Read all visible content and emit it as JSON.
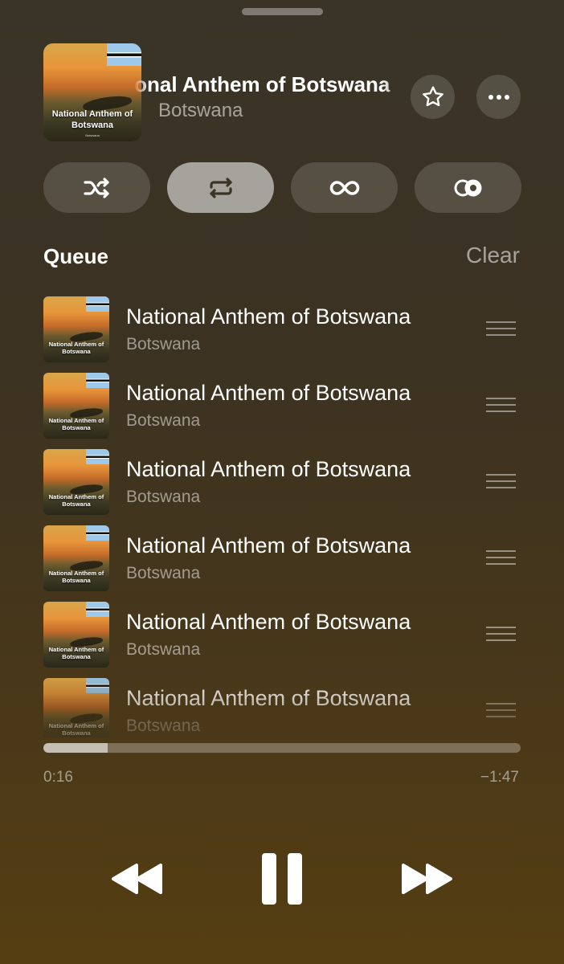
{
  "now_playing": {
    "title": "National Anthem of Botswana",
    "artist": "Botswana",
    "artwork_caption": "National Anthem of Botswana",
    "artwork_mini": "Botswana"
  },
  "modes": {
    "shuffle": "shuffle-icon",
    "repeat": "repeat-icon",
    "autoplay": "infinity-icon",
    "crossfade": "crossfade-icon",
    "active": "repeat"
  },
  "queue": {
    "label": "Queue",
    "clear_label": "Clear",
    "items": [
      {
        "title": "National Anthem of Botswana",
        "artist": "Botswana",
        "art_caption": "National Anthem of Botswana"
      },
      {
        "title": "National Anthem of Botswana",
        "artist": "Botswana",
        "art_caption": "National Anthem of Botswana"
      },
      {
        "title": "National Anthem of Botswana",
        "artist": "Botswana",
        "art_caption": "National Anthem of Botswana"
      },
      {
        "title": "National Anthem of Botswana",
        "artist": "Botswana",
        "art_caption": "National Anthem of Botswana"
      },
      {
        "title": "National Anthem of Botswana",
        "artist": "Botswana",
        "art_caption": "National Anthem of Botswana"
      },
      {
        "title": "National Anthem of Botswana",
        "artist": "Botswana",
        "art_caption": "National Anthem of Botswana"
      }
    ]
  },
  "playback": {
    "elapsed": "0:16",
    "remaining": "−1:47",
    "progress_fraction": 0.135,
    "state": "playing"
  },
  "colors": {
    "background_top": "#3a3428",
    "background_bottom": "#553e12",
    "accent": "#ffffff"
  }
}
